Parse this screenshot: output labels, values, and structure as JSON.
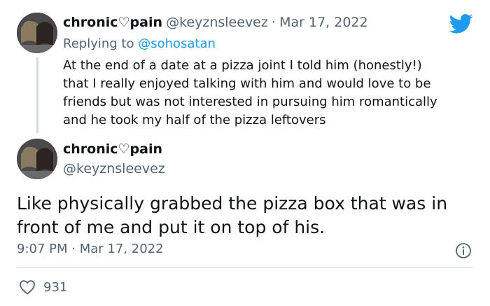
{
  "reply_tweet": {
    "display_name": "chronic♡pain",
    "handle": "@keyznsleevez",
    "separator": "·",
    "date": "Mar 17, 2022",
    "replying_prefix": "Replying to ",
    "replying_handle": "@sohosatan",
    "lines": [
      "At the end of a date at a pizza joint I told him (honestly!)",
      "that I really enjoyed talking with him and would love to be",
      "friends but was not interested in pursuing him romantically",
      "and he took my half of the pizza leftovers"
    ]
  },
  "main_tweet": {
    "display_name": "chronic♡pain",
    "handle": "@keyznsleevez",
    "lines": [
      "Like physically grabbed the pizza box that was in",
      "front of me and put it on top of his."
    ],
    "time": "9:07 PM",
    "separator": "·",
    "date": "Mar 17, 2022",
    "likes": "931"
  },
  "icons": {
    "brand": "twitter-bird-icon",
    "info": "info-icon",
    "like": "heart-icon"
  },
  "colors": {
    "twitter_blue": "#1d9bf0",
    "secondary_text": "#536471",
    "primary_text": "#0f1419",
    "divider": "#cfd9de"
  }
}
